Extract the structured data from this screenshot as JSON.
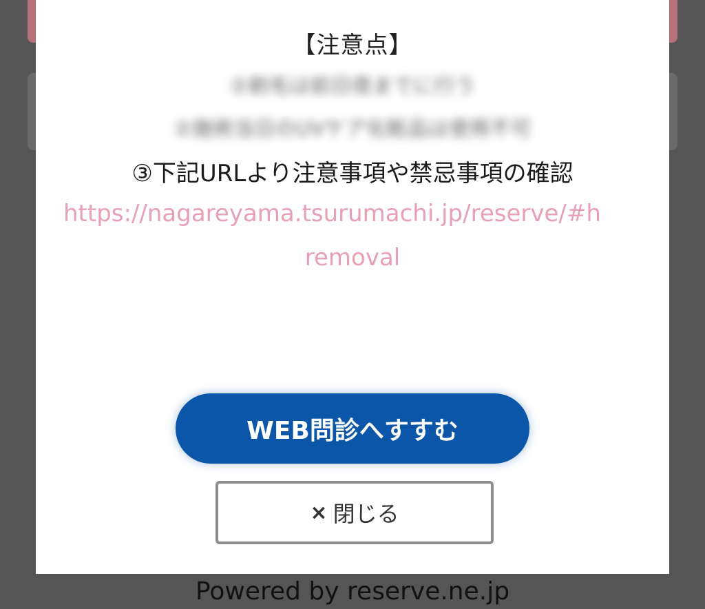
{
  "notice": {
    "title": "【注意点】",
    "blurred_line_1": "②剃毛は前日夜までに行う",
    "blurred_line_2": "②施術当日のUVケア化粧品は使用不可",
    "step3": "③下記URLより注意事項や禁忌事項の確認",
    "url_line_1": "https://nagareyama.tsurumachi.jp/reserve/#h",
    "url_line_2": "removal"
  },
  "buttons": {
    "primary_label": "WEB問診へすすむ",
    "close_icon": "×",
    "close_label": "閉じる"
  },
  "footer": {
    "powered_by": "Powered by reserve.ne.jp"
  },
  "colors": {
    "primary": "#0b56a8",
    "link": "#e8a0b4",
    "overlay": "#555555"
  }
}
